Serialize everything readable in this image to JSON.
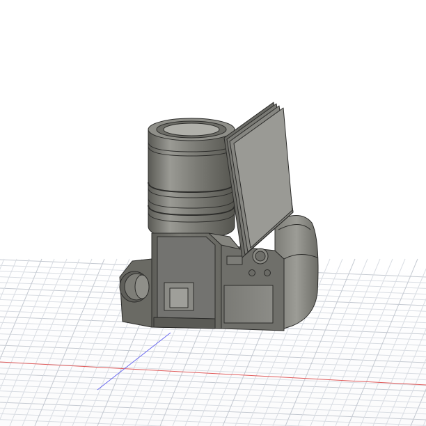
{
  "viewport": {
    "background": "#ffffff",
    "grid_color_minor": "#d9dde3",
    "grid_color_major": "#c4c9d1",
    "x_axis_color": "#e05a5a",
    "y_axis_color": "#6a6af0"
  },
  "model": {
    "body_color": "#6e6e68",
    "body_highlight": "#a7a7a1",
    "body_shadow": "#4a4a45",
    "edge_color": "#2c2c2a",
    "screen_color": "#8a8a85"
  }
}
